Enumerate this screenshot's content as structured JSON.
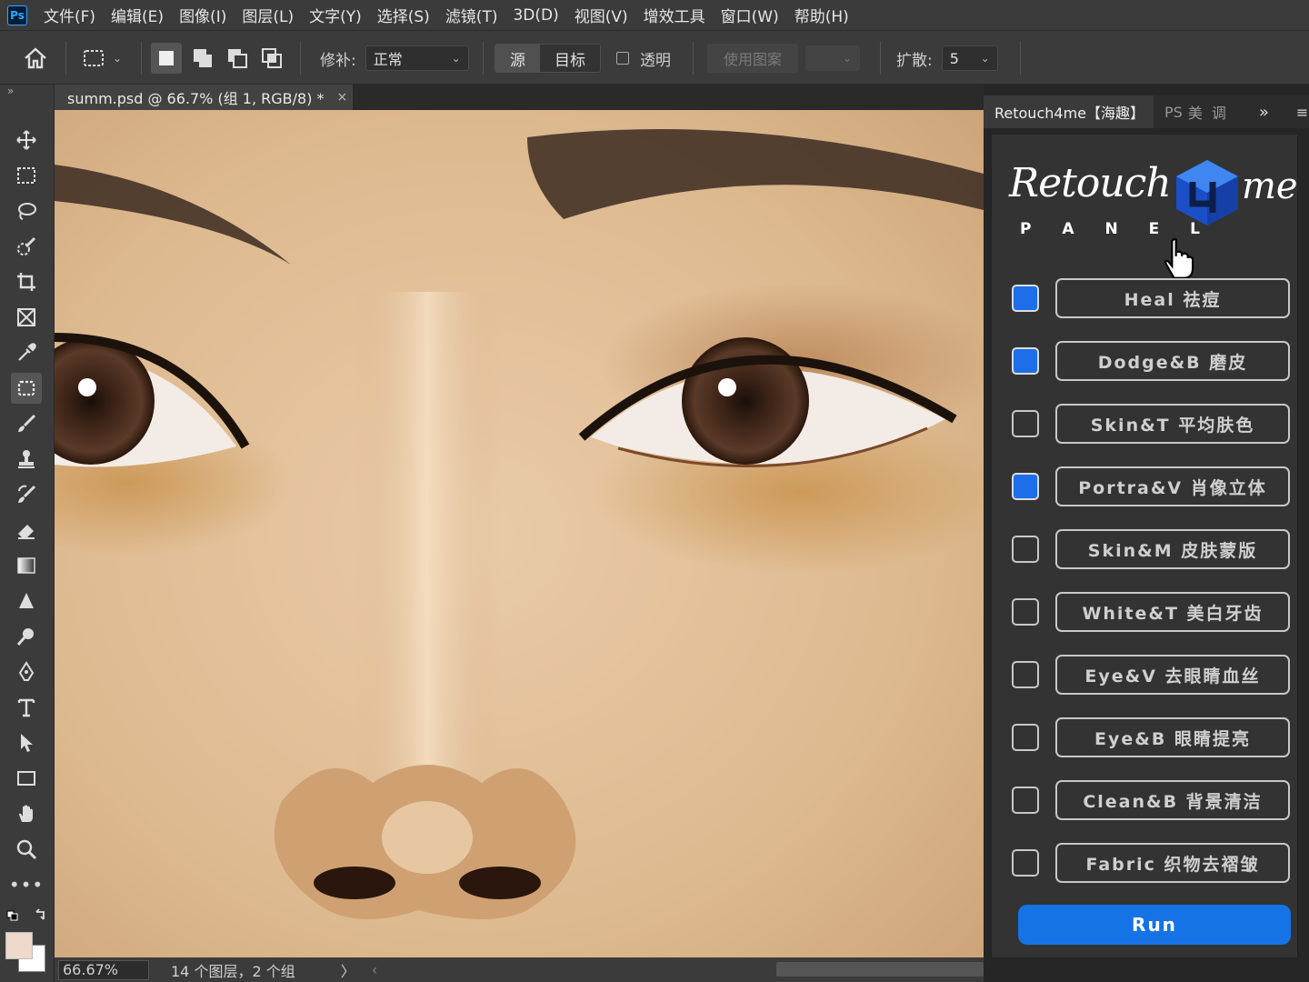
{
  "menubar": {
    "app_badge": "Ps",
    "items": [
      "文件(F)",
      "编辑(E)",
      "图像(I)",
      "图层(L)",
      "文字(Y)",
      "选择(S)",
      "滤镜(T)",
      "3D(D)",
      "视图(V)",
      "增效工具",
      "窗口(W)",
      "帮助(H)"
    ]
  },
  "options": {
    "patch_label": "修补:",
    "patch_mode": "正常",
    "source_label": "源",
    "target_label": "目标",
    "transparent_label": "透明",
    "use_pattern_label": "使用图案",
    "diffusion_label": "扩散:",
    "diffusion_value": "5"
  },
  "document": {
    "tab_title": "summ.psd @ 66.7% (组 1, RGB/8) *",
    "tab_close": "×"
  },
  "statusbar": {
    "zoom": "66.67%",
    "info": "14 个图层，2 个组",
    "arrow": "〉",
    "left_arrow": "‹"
  },
  "panel": {
    "tab_active": "Retouch4me【海趣】",
    "tab_ps": "PS",
    "tab_mei": "美",
    "tab_tiao": "调",
    "more": "»",
    "logo_text": "Retouch",
    "logo_me": "me",
    "logo_sub": "P A N E L",
    "colors": {
      "accent": "#1d6ee8",
      "run": "#1573e6"
    },
    "items": [
      {
        "label": "Heal 祛痘",
        "checked": true
      },
      {
        "label": "Dodge&B 磨皮",
        "checked": true
      },
      {
        "label": "Skin&T 平均肤色",
        "checked": false
      },
      {
        "label": "Portra&V 肖像立体",
        "checked": true
      },
      {
        "label": "Skin&M 皮肤蒙版",
        "checked": false
      },
      {
        "label": "White&T 美白牙齿",
        "checked": false
      },
      {
        "label": "Eye&V 去眼睛血丝",
        "checked": false
      },
      {
        "label": "Eye&B 眼睛提亮",
        "checked": false
      },
      {
        "label": "Clean&B 背景清洁",
        "checked": false
      },
      {
        "label": "Fabric 织物去褶皱",
        "checked": false
      }
    ],
    "run_label": "Run"
  }
}
